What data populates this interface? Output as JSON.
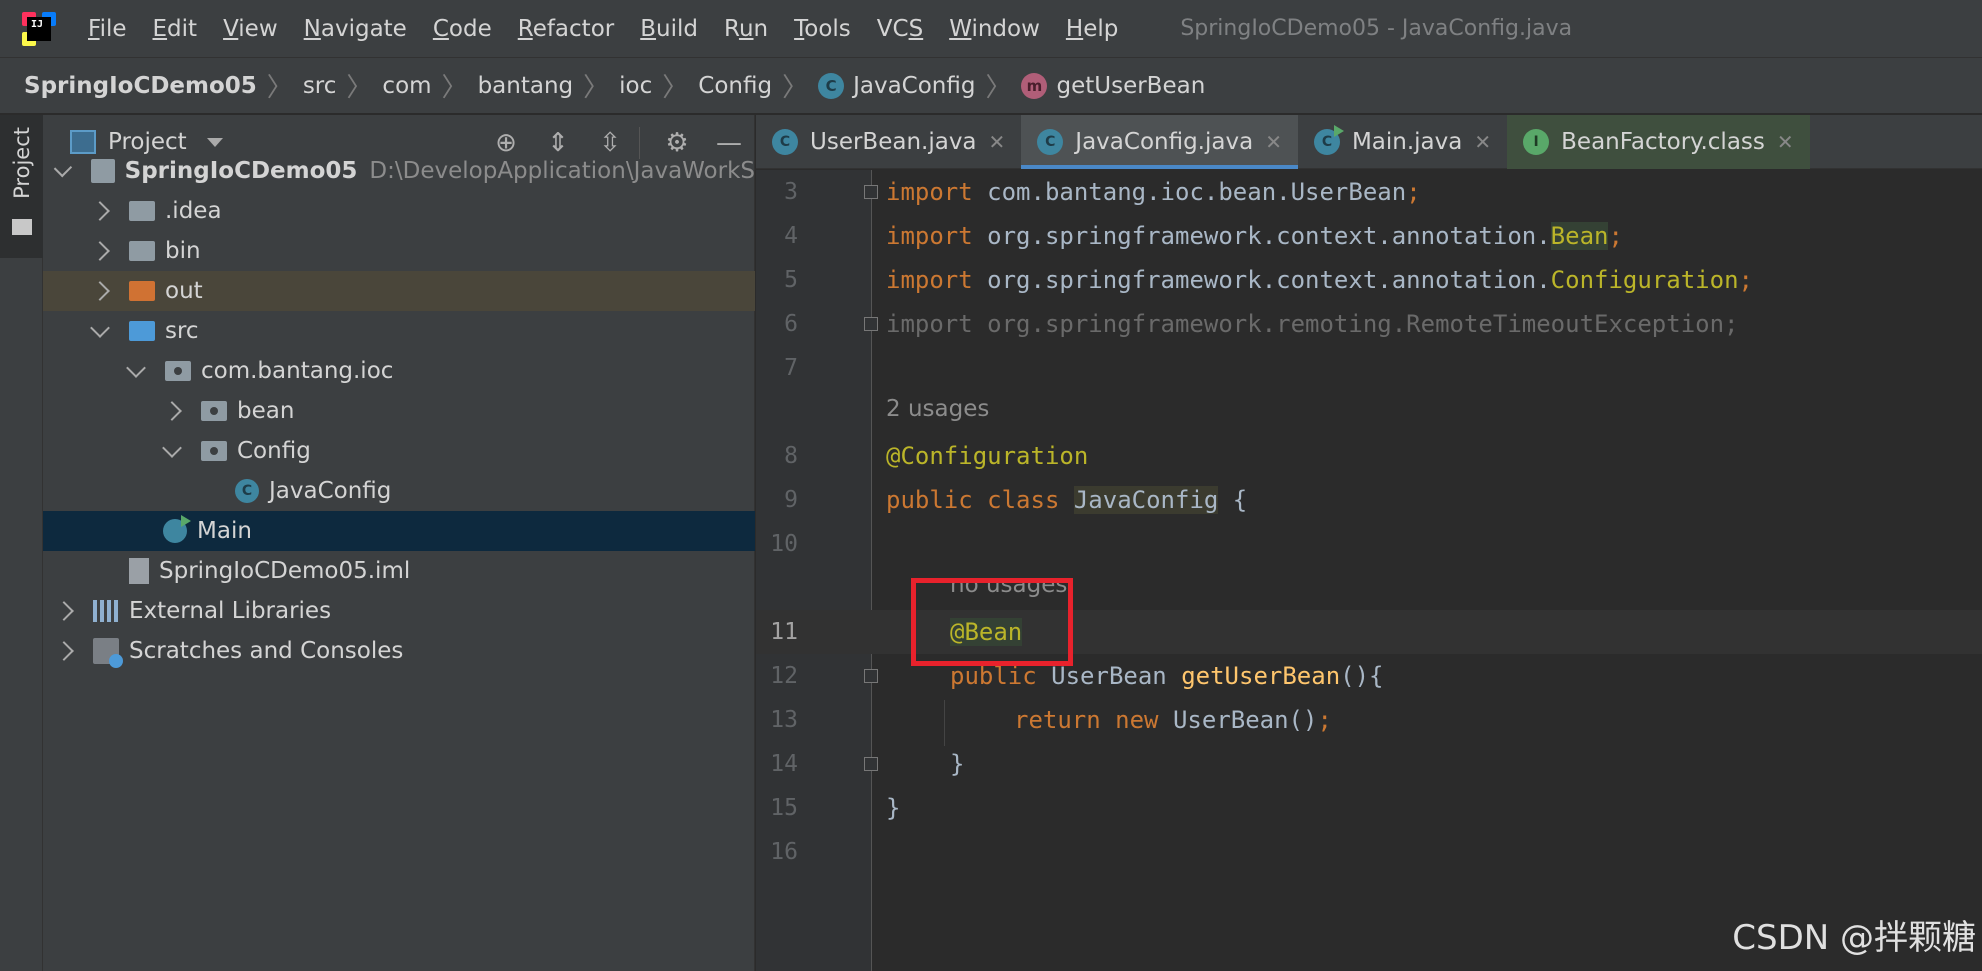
{
  "menu": {
    "items": [
      {
        "label": "File",
        "mnemonic": "F",
        "rest": "ile"
      },
      {
        "label": "Edit",
        "mnemonic": "E",
        "rest": "dit"
      },
      {
        "label": "View",
        "mnemonic": "V",
        "rest": "iew"
      },
      {
        "label": "Navigate",
        "mnemonic": "N",
        "rest": "avigate"
      },
      {
        "label": "Code",
        "mnemonic": "C",
        "rest": "ode"
      },
      {
        "label": "Refactor",
        "mnemonic": "R",
        "rest": "efactor"
      },
      {
        "label": "Build",
        "mnemonic": "B",
        "rest": "uild"
      },
      {
        "label": "Run",
        "mnemonic": "u",
        "prefix": "R",
        "rest": "n"
      },
      {
        "label": "Tools",
        "mnemonic": "T",
        "rest": "ools"
      },
      {
        "label": "VCS",
        "mnemonic": "S",
        "prefix": "VC",
        "rest": ""
      },
      {
        "label": "Window",
        "mnemonic": "W",
        "rest": "indow"
      },
      {
        "label": "Help",
        "mnemonic": "H",
        "rest": "elp"
      }
    ],
    "window_title": "SpringIoCDemo05 - JavaConfig.java"
  },
  "breadcrumb": {
    "items": [
      "SpringIoCDemo05",
      "src",
      "com",
      "bantang",
      "ioc",
      "Config",
      "JavaConfig",
      "getUserBean"
    ]
  },
  "toolstrip": {
    "project_tab": "Project"
  },
  "project_panel": {
    "title": "Project",
    "tree": {
      "root_name": "SpringIoCDemo05",
      "root_path": "D:\\DevelopApplication\\JavaWorkS",
      "idea": ".idea",
      "bin": "bin",
      "out": "out",
      "src": "src",
      "pkg": "com.bantang.ioc",
      "bean": "bean",
      "config": "Config",
      "javaconfig": "JavaConfig",
      "main": "Main",
      "iml": "SpringIoCDemo05.iml",
      "ext_libs": "External Libraries",
      "scratches": "Scratches and Consoles"
    }
  },
  "tabs": [
    {
      "label": "UserBean.java",
      "icon": "C"
    },
    {
      "label": "JavaConfig.java",
      "icon": "C"
    },
    {
      "label": "Main.java",
      "icon": "C"
    },
    {
      "label": "BeanFactory.class",
      "icon": "I"
    }
  ],
  "editor": {
    "line_numbers": [
      "3",
      "4",
      "5",
      "6",
      "7",
      "8",
      "9",
      "10",
      "11",
      "12",
      "13",
      "14",
      "15",
      "16"
    ],
    "l3": {
      "kw": "import",
      "rest": " com.bantang.ioc.bean.UserBean",
      "semi": ";"
    },
    "l4": {
      "kw": "import",
      "rest": " org.springframework.context.annotation.",
      "hl": "Bean",
      "semi": ";"
    },
    "l5": {
      "kw": "import",
      "rest": " org.springframework.context.annotation.",
      "hl": "Configuration",
      "semi": ";"
    },
    "l6": {
      "text": "import org.springframework.remoting.RemoteTimeoutException;"
    },
    "usages_1": "2 usages",
    "l8": {
      "ann": "@Configuration"
    },
    "l9": {
      "kw1": "public",
      "kw2": "class",
      "name": "JavaConfig",
      "rest": " {"
    },
    "usages_2": "no usages",
    "l11": {
      "ann": "@Bean"
    },
    "l12": {
      "kw": "public",
      "type": " UserBean ",
      "meth": "getUserBean",
      "rest": "(){"
    },
    "l13": {
      "kw1": "return",
      "kw2": "new",
      "rest": " UserBean()",
      "semi": ";"
    },
    "l14": {
      "text": "}"
    },
    "l15": {
      "text": "}"
    }
  },
  "watermark": "CSDN @拌颗糖"
}
